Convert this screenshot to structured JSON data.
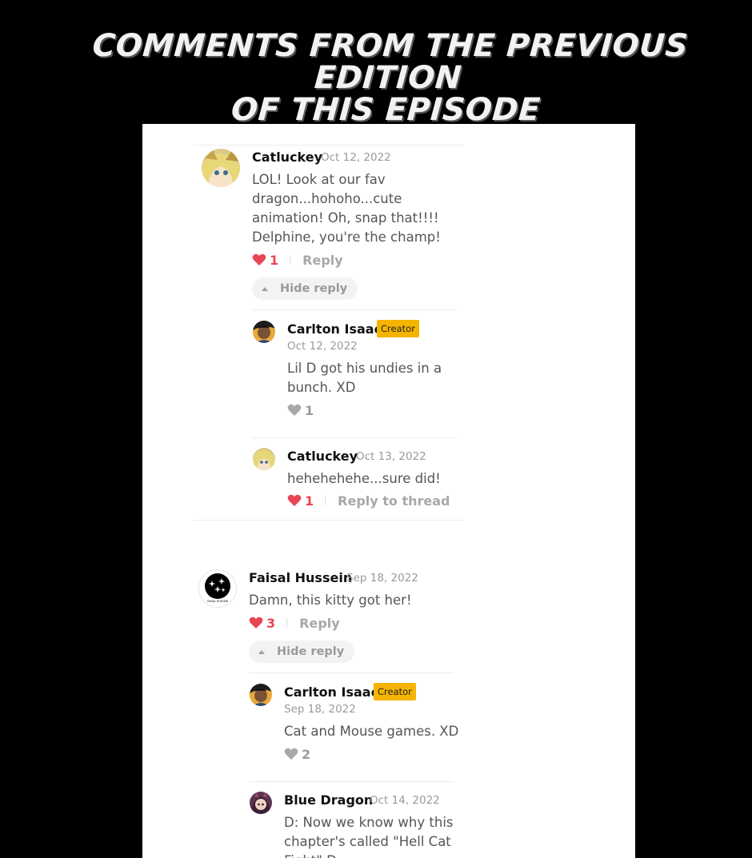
{
  "banner": {
    "title_line1": "COMMENTS FROM THE PREVIOUS EDITION",
    "title_line2": "OF THIS EPISODE"
  },
  "colors": {
    "background": "#000000",
    "panel": "#ffffff",
    "like_active": "#e84654",
    "like_inactive": "#9a9a9a",
    "creator_badge": "#f5b400"
  },
  "threads": [
    {
      "author": "Catluckey",
      "date": "Oct 12, 2022",
      "text": "LOL! Look at our fav dragon...hohoho...cute animation! Oh, snap that!!!! Delphine, you're the champ!",
      "likes": "1",
      "liked": true,
      "reply_label": "Reply",
      "hide_label": "Hide reply",
      "avatar_icon": "anime-girl-avatar",
      "replies": [
        {
          "author": "Carlton Isaac",
          "badge": "Creator",
          "date": "Oct 12, 2022",
          "text": "Lil D got his undies in a bunch. XD",
          "likes": "1",
          "liked": false,
          "avatar_icon": "creator-avatar"
        },
        {
          "author": "Catluckey",
          "date": "Oct 13, 2022",
          "text": "hehehehehe...sure did!",
          "likes": "1",
          "liked": true,
          "reply_label": "Reply to thread",
          "avatar_icon": "anime-girl-avatar"
        }
      ]
    },
    {
      "author": "Faisal Hussein",
      "date": "Sep 18, 2022",
      "text": "Damn, this kitty got her!",
      "likes": "3",
      "liked": true,
      "reply_label": "Reply",
      "hide_label": "Hide reply",
      "avatar_icon": "stars-logo-avatar",
      "avatar_caption": "FAISAL HUSSEIN",
      "replies": [
        {
          "author": "Carlton Isaac",
          "badge": "Creator",
          "date": "Sep 18, 2022",
          "text": "Cat and Mouse games. XD",
          "likes": "2",
          "liked": false,
          "avatar_icon": "creator-avatar"
        },
        {
          "author": "Blue Dragon",
          "date": "Oct 14, 2022",
          "text": "D: Now we know why this chapter's called \"Hell Cat Fight\" D:",
          "avatar_icon": "dragon-girl-avatar"
        }
      ]
    }
  ]
}
